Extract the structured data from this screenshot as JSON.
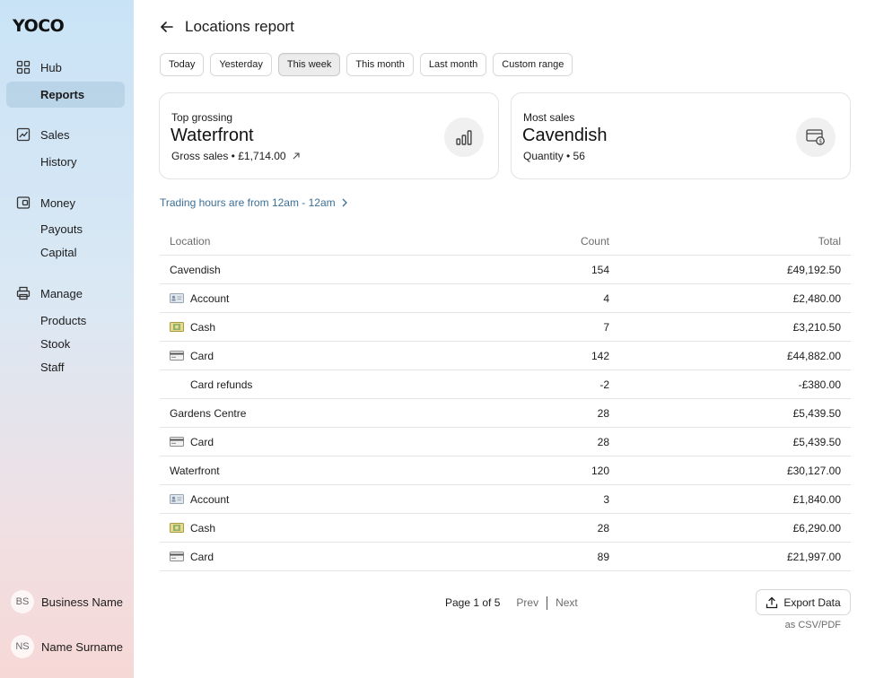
{
  "app": {
    "logo": "YOCO"
  },
  "sidebar": {
    "groups": [
      {
        "label": "Hub",
        "icon": "grid-icon",
        "items": [
          {
            "label": "Reports",
            "active": true
          }
        ]
      },
      {
        "label": "Sales",
        "icon": "chart-line-icon",
        "items": [
          {
            "label": "History"
          }
        ]
      },
      {
        "label": "Money",
        "icon": "wallet-icon",
        "items": [
          {
            "label": "Payouts"
          },
          {
            "label": "Capital"
          }
        ]
      },
      {
        "label": "Manage",
        "icon": "printer-icon",
        "items": [
          {
            "label": "Products"
          },
          {
            "label": "Stook"
          },
          {
            "label": "Staff"
          }
        ]
      }
    ],
    "business": {
      "initials": "BS",
      "name": "Business Name"
    },
    "user": {
      "initials": "NS",
      "name": "Name Surname"
    },
    "active_color": "#a0bed7"
  },
  "header": {
    "title": "Locations report"
  },
  "filters": [
    {
      "label": "Today",
      "active": false
    },
    {
      "label": "Yesterday",
      "active": false
    },
    {
      "label": "This week",
      "active": true
    },
    {
      "label": "This month",
      "active": false
    },
    {
      "label": "Last month",
      "active": false
    },
    {
      "label": "Custom range",
      "active": false
    }
  ],
  "summary": {
    "top_grossing": {
      "label": "Top grossing",
      "value": "Waterfront",
      "detail": "Gross sales • £1,714.00",
      "icon": "bar-chart-icon"
    },
    "most_sales": {
      "label": "Most sales",
      "value": "Cavendish",
      "detail": "Quantity • 56",
      "icon": "card-coin-icon"
    }
  },
  "trading_hours": {
    "text": "Trading hours are from 12am - 12am",
    "link_color": "#3c6f96"
  },
  "table": {
    "headers": {
      "location": "Location",
      "count": "Count",
      "total": "Total"
    },
    "rows": [
      {
        "location": "Cavendish",
        "count": "154",
        "total": "£49,192.50",
        "icon": null
      },
      {
        "location": "Account",
        "count": "4",
        "total": "£2,480.00",
        "icon": "account-card-icon"
      },
      {
        "location": "Cash",
        "count": "7",
        "total": "£3,210.50",
        "icon": "cash-icon"
      },
      {
        "location": "Card",
        "count": "142",
        "total": "£44,882.00",
        "icon": "credit-card-icon"
      },
      {
        "location": "Card refunds",
        "count": "-2",
        "total": "-£380.00",
        "icon": null,
        "indent": true
      },
      {
        "location": "Gardens Centre",
        "count": "28",
        "total": "£5,439.50",
        "icon": null
      },
      {
        "location": "Card",
        "count": "28",
        "total": "£5,439.50",
        "icon": "credit-card-icon"
      },
      {
        "location": "Waterfront",
        "count": "120",
        "total": "£30,127.00",
        "icon": null
      },
      {
        "location": "Account",
        "count": "3",
        "total": "£1,840.00",
        "icon": "account-card-icon"
      },
      {
        "location": "Cash",
        "count": "28",
        "total": "£6,290.00",
        "icon": "cash-icon"
      },
      {
        "location": "Card",
        "count": "89",
        "total": "£21,997.00",
        "icon": "credit-card-icon"
      }
    ]
  },
  "pagination": {
    "label": "Page 1 of 5",
    "prev": "Prev",
    "next": "Next"
  },
  "export": {
    "label": "Export Data",
    "note": "as CSV/PDF"
  }
}
